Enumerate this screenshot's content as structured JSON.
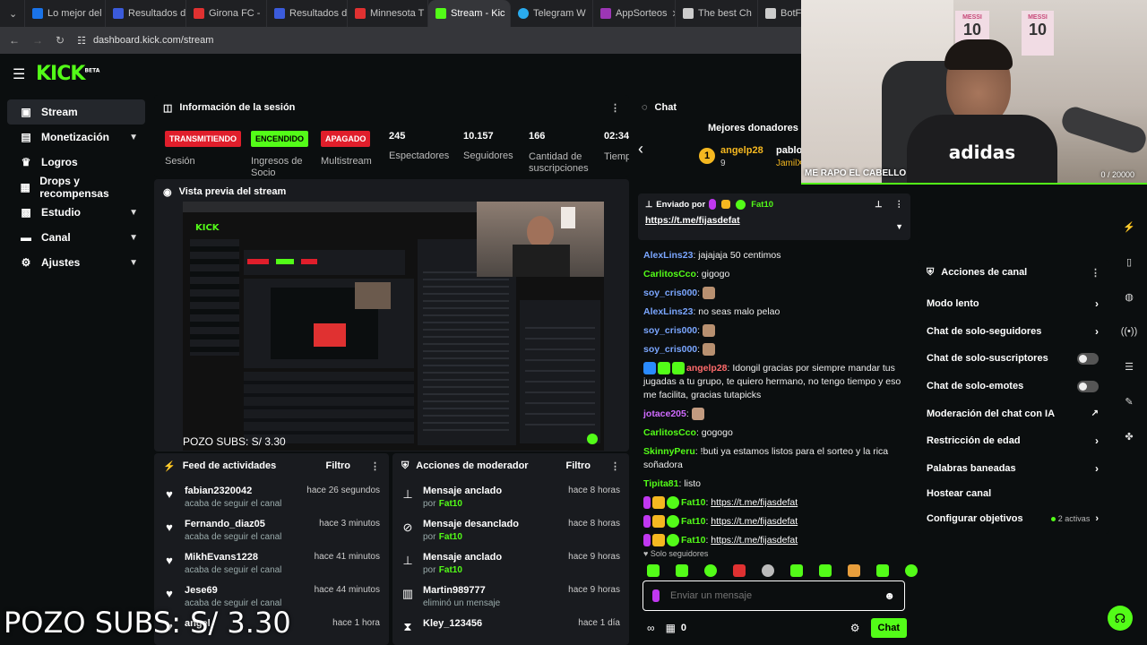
{
  "browser": {
    "tabs": [
      {
        "label": "Lo mejor del",
        "color": "#1a73e8"
      },
      {
        "label": "Resultados d",
        "color": "#3b5bdb"
      },
      {
        "label": "Girona FC -",
        "color": "#e03131"
      },
      {
        "label": "Resultados d",
        "color": "#3b5bdb"
      },
      {
        "label": "Minnesota T",
        "color": "#e03131"
      },
      {
        "label": "Stream - Kic",
        "color": "#53fc18"
      },
      {
        "label": "Telegram W",
        "color": "#2aabee"
      },
      {
        "label": "AppSorteos",
        "color": "#9c36b5"
      },
      {
        "label": "The best Ch",
        "color": "#cccccc"
      },
      {
        "label": "BotF",
        "color": "#cccccc"
      }
    ],
    "url": "dashboard.kick.com/stream"
  },
  "brand": {
    "logo": "KICK",
    "beta": "BETA",
    "accent": "#53fc18"
  },
  "sidebar": {
    "items": [
      {
        "label": "Stream",
        "icon": "video-icon"
      },
      {
        "label": "Monetización",
        "icon": "money-icon"
      },
      {
        "label": "Logros",
        "icon": "trophy-icon"
      },
      {
        "label": "Drops y recompensas",
        "icon": "gift-icon"
      },
      {
        "label": "Estudio",
        "icon": "grid-icon"
      },
      {
        "label": "Canal",
        "icon": "channel-icon"
      },
      {
        "label": "Ajustes",
        "icon": "gear-icon"
      }
    ]
  },
  "session": {
    "title": "Información de la sesión",
    "stats": [
      {
        "label": "Sesión",
        "badge": "TRANSMITIENDO",
        "badge_color": "#e01e2b"
      },
      {
        "label": "Ingresos de Socio",
        "badge": "ENCENDIDO",
        "badge_color": "#53fc18"
      },
      {
        "label": "Multistream",
        "badge": "APAGADO",
        "badge_color": "#e01e2b"
      },
      {
        "label": "Espectadores",
        "value": "245"
      },
      {
        "label": "Seguidores",
        "value": "10.157"
      },
      {
        "label": "Cantidad de suscripciones",
        "value": "166"
      },
      {
        "label": "Tiempo en vivo",
        "value": "02:34"
      }
    ]
  },
  "preview": {
    "title": "Vista previa del stream",
    "overlay_small": "POZO SUBS: S/ 3.30"
  },
  "feed": {
    "title": "Feed de actividades",
    "filter": "Filtro",
    "items": [
      {
        "user": "fabian2320042",
        "action": "acaba de seguir el canal",
        "time": "hace 26 segundos"
      },
      {
        "user": "Fernando_diaz05",
        "action": "acaba de seguir el canal",
        "time": "hace 3 minutos"
      },
      {
        "user": "MikhEvans1228",
        "action": "acaba de seguir el canal",
        "time": "hace 41 minutos"
      },
      {
        "user": "Jese69",
        "action": "acaba de seguir el canal",
        "time": "hace 44 minutos"
      },
      {
        "user": "angel",
        "action": "",
        "time": "hace 1 hora"
      }
    ]
  },
  "modactions": {
    "title": "Acciones de moderador",
    "filter": "Filtro",
    "items": [
      {
        "title": "Mensaje anclado",
        "by": "por",
        "user": "Fat10",
        "time": "hace 8 horas",
        "icon": "pin-icon"
      },
      {
        "title": "Mensaje desanclado",
        "by": "por",
        "user": "Fat10",
        "time": "hace 8 horas",
        "icon": "unpin-icon"
      },
      {
        "title": "Mensaje anclado",
        "by": "por",
        "user": "Fat10",
        "time": "hace 9 horas",
        "icon": "pin-icon"
      },
      {
        "title": "Martin989777",
        "by": "eliminó un mensaje",
        "user": "",
        "time": "hace 9 horas",
        "icon": "trash-icon"
      },
      {
        "title": "Kley_123456",
        "by": "",
        "user": "",
        "time": "hace 1 día",
        "icon": "hourglass-icon"
      }
    ]
  },
  "chat": {
    "title": "Chat",
    "donors_title": "Mejores donadores de l",
    "donor1": {
      "rank": "1",
      "name": "angelp28",
      "count": "9"
    },
    "donor2": {
      "name": "pablor",
      "sub": "JamilX"
    },
    "pinned": {
      "label": "Enviado por",
      "user": "Fat10",
      "link": "https://t.me/fijasdefat"
    },
    "messages": [
      {
        "user": "AlexLins23",
        "color": "#7aa6ff",
        "text": ": jajajaja 50 centimos"
      },
      {
        "user": "CarlitosCco",
        "color": "#53fc18",
        "text": ": gigogo"
      },
      {
        "user": "soy_cris000",
        "color": "#7aa6ff",
        "text": ":"
      },
      {
        "user": "AlexLins23",
        "color": "#7aa6ff",
        "text": ": no seas malo pelao"
      },
      {
        "user": "soy_cris000",
        "color": "#7aa6ff",
        "text": ":"
      },
      {
        "user": "soy_cris000",
        "color": "#7aa6ff",
        "text": ":"
      },
      {
        "user": "angelp28",
        "color": "#ff6b6b",
        "text": ": Idongil gracias por siempre mandar tus jugadas a tu grupo, te quiero hermano, no tengo tiempo y eso me facilita, gracias tutapicks"
      },
      {
        "user": "jotace205",
        "color": "#d06bff",
        "text": ":"
      },
      {
        "user": "CarlitosCco",
        "color": "#53fc18",
        "text": ": gogogo"
      },
      {
        "user": "SkinnyPeru",
        "color": "#53fc18",
        "text": ": !buti ya estamos listos para el sorteo y la rica soñadora"
      },
      {
        "user": "Tipita81",
        "color": "#53fc18",
        "text": ": listo"
      }
    ],
    "fat_messages": [
      {
        "user": "Fat10",
        "link": "https://t.me/fijasdefat"
      },
      {
        "user": "Fat10",
        "link": "https://t.me/fijasdefat"
      },
      {
        "user": "Fat10",
        "link": "https://t.me/fijasdefat"
      }
    ],
    "followers_only": "Solo seguidores",
    "input_placeholder": "Enviar un mensaje",
    "count": "0",
    "send": "Chat"
  },
  "channel_actions": {
    "title": "Acciones de canal",
    "items": [
      {
        "label": "Modo lento",
        "right": "chevron"
      },
      {
        "label": "Chat de solo-seguidores",
        "right": "chevron"
      },
      {
        "label": "Chat de solo-suscriptores",
        "right": "toggle"
      },
      {
        "label": "Chat de solo-emotes",
        "right": "toggle"
      },
      {
        "label": "Moderación del chat con IA",
        "right": "external"
      },
      {
        "label": "Restricción de edad",
        "right": "chevron"
      },
      {
        "label": "Palabras baneadas",
        "right": "chevron"
      },
      {
        "label": "Hostear canal",
        "right": "none"
      },
      {
        "label": "Configurar objetivos",
        "right": "chevron",
        "extra": "2 activas"
      }
    ]
  },
  "webcam": {
    "overlay": "ME RAPO EL CABELLO",
    "progress": "0 / 20000",
    "shirt": "adidas",
    "poster": "MESSI",
    "number": "10"
  },
  "overlay": {
    "pozo": "POZO SUBS: S/ 3.30"
  }
}
